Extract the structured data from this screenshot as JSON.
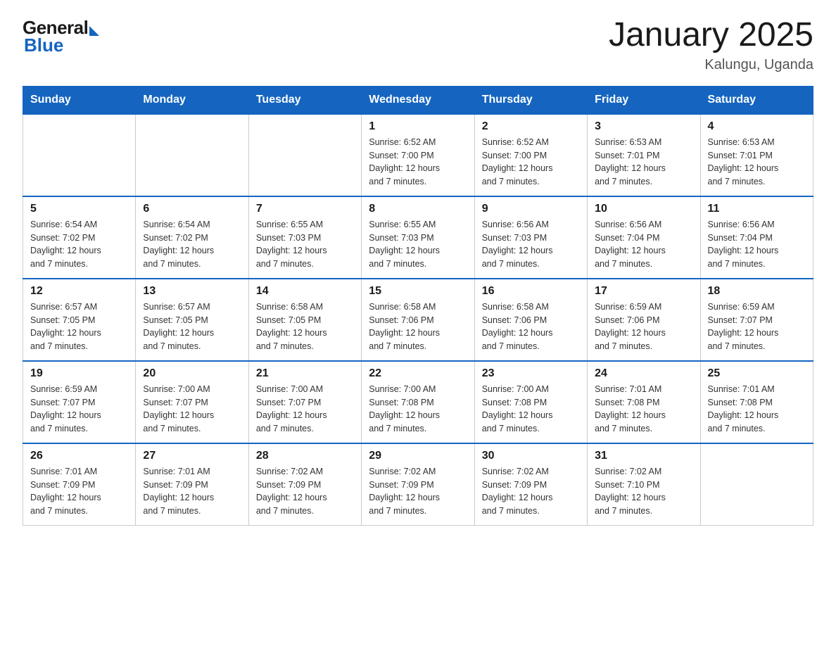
{
  "header": {
    "logo": {
      "general": "General",
      "blue": "Blue"
    },
    "title": "January 2025",
    "subtitle": "Kalungu, Uganda"
  },
  "calendar": {
    "days_of_week": [
      "Sunday",
      "Monday",
      "Tuesday",
      "Wednesday",
      "Thursday",
      "Friday",
      "Saturday"
    ],
    "weeks": [
      [
        {
          "day": "",
          "info": ""
        },
        {
          "day": "",
          "info": ""
        },
        {
          "day": "",
          "info": ""
        },
        {
          "day": "1",
          "info": "Sunrise: 6:52 AM\nSunset: 7:00 PM\nDaylight: 12 hours\nand 7 minutes."
        },
        {
          "day": "2",
          "info": "Sunrise: 6:52 AM\nSunset: 7:00 PM\nDaylight: 12 hours\nand 7 minutes."
        },
        {
          "day": "3",
          "info": "Sunrise: 6:53 AM\nSunset: 7:01 PM\nDaylight: 12 hours\nand 7 minutes."
        },
        {
          "day": "4",
          "info": "Sunrise: 6:53 AM\nSunset: 7:01 PM\nDaylight: 12 hours\nand 7 minutes."
        }
      ],
      [
        {
          "day": "5",
          "info": "Sunrise: 6:54 AM\nSunset: 7:02 PM\nDaylight: 12 hours\nand 7 minutes."
        },
        {
          "day": "6",
          "info": "Sunrise: 6:54 AM\nSunset: 7:02 PM\nDaylight: 12 hours\nand 7 minutes."
        },
        {
          "day": "7",
          "info": "Sunrise: 6:55 AM\nSunset: 7:03 PM\nDaylight: 12 hours\nand 7 minutes."
        },
        {
          "day": "8",
          "info": "Sunrise: 6:55 AM\nSunset: 7:03 PM\nDaylight: 12 hours\nand 7 minutes."
        },
        {
          "day": "9",
          "info": "Sunrise: 6:56 AM\nSunset: 7:03 PM\nDaylight: 12 hours\nand 7 minutes."
        },
        {
          "day": "10",
          "info": "Sunrise: 6:56 AM\nSunset: 7:04 PM\nDaylight: 12 hours\nand 7 minutes."
        },
        {
          "day": "11",
          "info": "Sunrise: 6:56 AM\nSunset: 7:04 PM\nDaylight: 12 hours\nand 7 minutes."
        }
      ],
      [
        {
          "day": "12",
          "info": "Sunrise: 6:57 AM\nSunset: 7:05 PM\nDaylight: 12 hours\nand 7 minutes."
        },
        {
          "day": "13",
          "info": "Sunrise: 6:57 AM\nSunset: 7:05 PM\nDaylight: 12 hours\nand 7 minutes."
        },
        {
          "day": "14",
          "info": "Sunrise: 6:58 AM\nSunset: 7:05 PM\nDaylight: 12 hours\nand 7 minutes."
        },
        {
          "day": "15",
          "info": "Sunrise: 6:58 AM\nSunset: 7:06 PM\nDaylight: 12 hours\nand 7 minutes."
        },
        {
          "day": "16",
          "info": "Sunrise: 6:58 AM\nSunset: 7:06 PM\nDaylight: 12 hours\nand 7 minutes."
        },
        {
          "day": "17",
          "info": "Sunrise: 6:59 AM\nSunset: 7:06 PM\nDaylight: 12 hours\nand 7 minutes."
        },
        {
          "day": "18",
          "info": "Sunrise: 6:59 AM\nSunset: 7:07 PM\nDaylight: 12 hours\nand 7 minutes."
        }
      ],
      [
        {
          "day": "19",
          "info": "Sunrise: 6:59 AM\nSunset: 7:07 PM\nDaylight: 12 hours\nand 7 minutes."
        },
        {
          "day": "20",
          "info": "Sunrise: 7:00 AM\nSunset: 7:07 PM\nDaylight: 12 hours\nand 7 minutes."
        },
        {
          "day": "21",
          "info": "Sunrise: 7:00 AM\nSunset: 7:07 PM\nDaylight: 12 hours\nand 7 minutes."
        },
        {
          "day": "22",
          "info": "Sunrise: 7:00 AM\nSunset: 7:08 PM\nDaylight: 12 hours\nand 7 minutes."
        },
        {
          "day": "23",
          "info": "Sunrise: 7:00 AM\nSunset: 7:08 PM\nDaylight: 12 hours\nand 7 minutes."
        },
        {
          "day": "24",
          "info": "Sunrise: 7:01 AM\nSunset: 7:08 PM\nDaylight: 12 hours\nand 7 minutes."
        },
        {
          "day": "25",
          "info": "Sunrise: 7:01 AM\nSunset: 7:08 PM\nDaylight: 12 hours\nand 7 minutes."
        }
      ],
      [
        {
          "day": "26",
          "info": "Sunrise: 7:01 AM\nSunset: 7:09 PM\nDaylight: 12 hours\nand 7 minutes."
        },
        {
          "day": "27",
          "info": "Sunrise: 7:01 AM\nSunset: 7:09 PM\nDaylight: 12 hours\nand 7 minutes."
        },
        {
          "day": "28",
          "info": "Sunrise: 7:02 AM\nSunset: 7:09 PM\nDaylight: 12 hours\nand 7 minutes."
        },
        {
          "day": "29",
          "info": "Sunrise: 7:02 AM\nSunset: 7:09 PM\nDaylight: 12 hours\nand 7 minutes."
        },
        {
          "day": "30",
          "info": "Sunrise: 7:02 AM\nSunset: 7:09 PM\nDaylight: 12 hours\nand 7 minutes."
        },
        {
          "day": "31",
          "info": "Sunrise: 7:02 AM\nSunset: 7:10 PM\nDaylight: 12 hours\nand 7 minutes."
        },
        {
          "day": "",
          "info": ""
        }
      ]
    ]
  }
}
